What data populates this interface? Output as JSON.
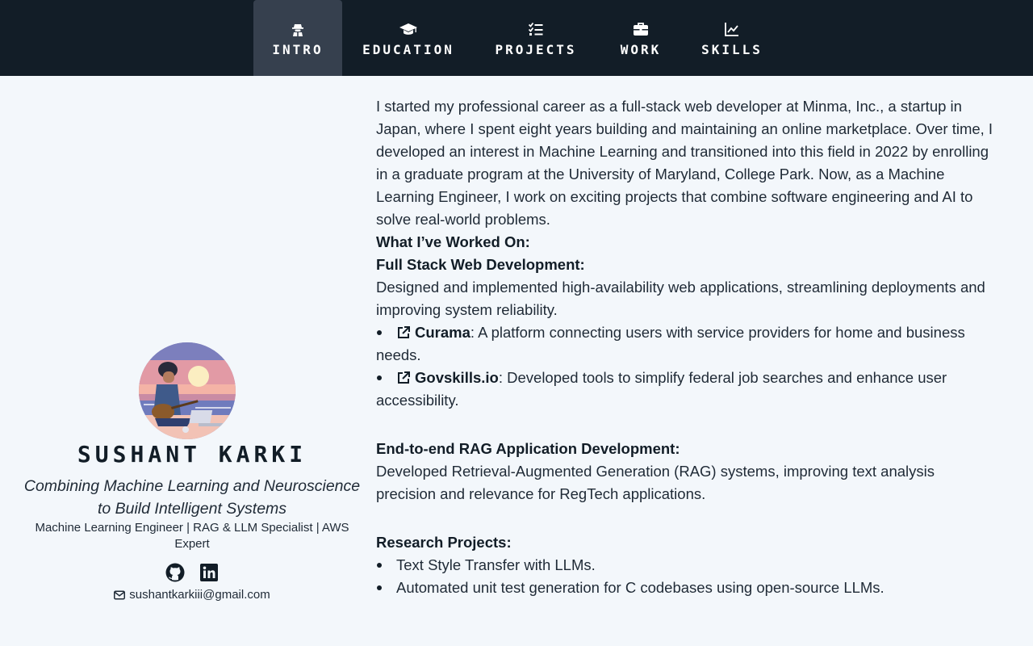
{
  "nav": {
    "items": [
      {
        "label": "Intro",
        "icon": "user-secret-icon",
        "active": true
      },
      {
        "label": "Education",
        "icon": "graduation-cap-icon",
        "active": false
      },
      {
        "label": "Projects",
        "icon": "list-check-icon",
        "active": false
      },
      {
        "label": "Work",
        "icon": "briefcase-icon",
        "active": false
      },
      {
        "label": "Skills",
        "icon": "chart-line-icon",
        "active": false
      }
    ]
  },
  "profile": {
    "name": "Sushant Karki",
    "tagline": "Combining Machine Learning and Neuroscience to Build Intelligent Systems",
    "role": "Machine Learning Engineer | RAG & LLM Specialist | AWS Expert",
    "email": "sushantkarkiii@gmail.com",
    "social": [
      "github-icon",
      "linkedin-icon"
    ]
  },
  "content": {
    "intro": "I started my professional career as a full-stack web developer at Minma, Inc., a startup in Japan, where I spent eight years building and maintaining an online marketplace. Over time, I developed an interest in Machine Learning and transitioned into this field in 2022 by enrolling in a graduate program at the University of Maryland, College Park. Now, as a Machine Learning Engineer, I work on exciting projects that combine software engineering and AI to solve real-world problems.",
    "worked_on_heading": "What I’ve Worked On:",
    "fullstack": {
      "title": "Full Stack Web Development:",
      "description": "Designed and implemented high-availability web applications, streamlining deployments and improving system reliability.",
      "items": [
        {
          "name": "Curama",
          "text": ": A platform connecting users with service providers for home and business needs."
        },
        {
          "name": "Govskills.io",
          "text": ": Developed tools to simplify federal job searches and enhance user accessibility."
        }
      ]
    },
    "rag": {
      "title": "End-to-end RAG Application Development:",
      "description": "Developed Retrieval-Augmented Generation (RAG) systems, improving text analysis precision and relevance for RegTech applications."
    },
    "research": {
      "title": "Research Projects:",
      "items": [
        "Text Style Transfer with LLMs.",
        "Automated unit test generation for C codebases using open-source LLMs."
      ]
    }
  },
  "colors": {
    "nav_bg": "#121d27",
    "nav_active": "#36404e",
    "page_bg": "#f3f7fb",
    "text": "#1f2a36"
  }
}
